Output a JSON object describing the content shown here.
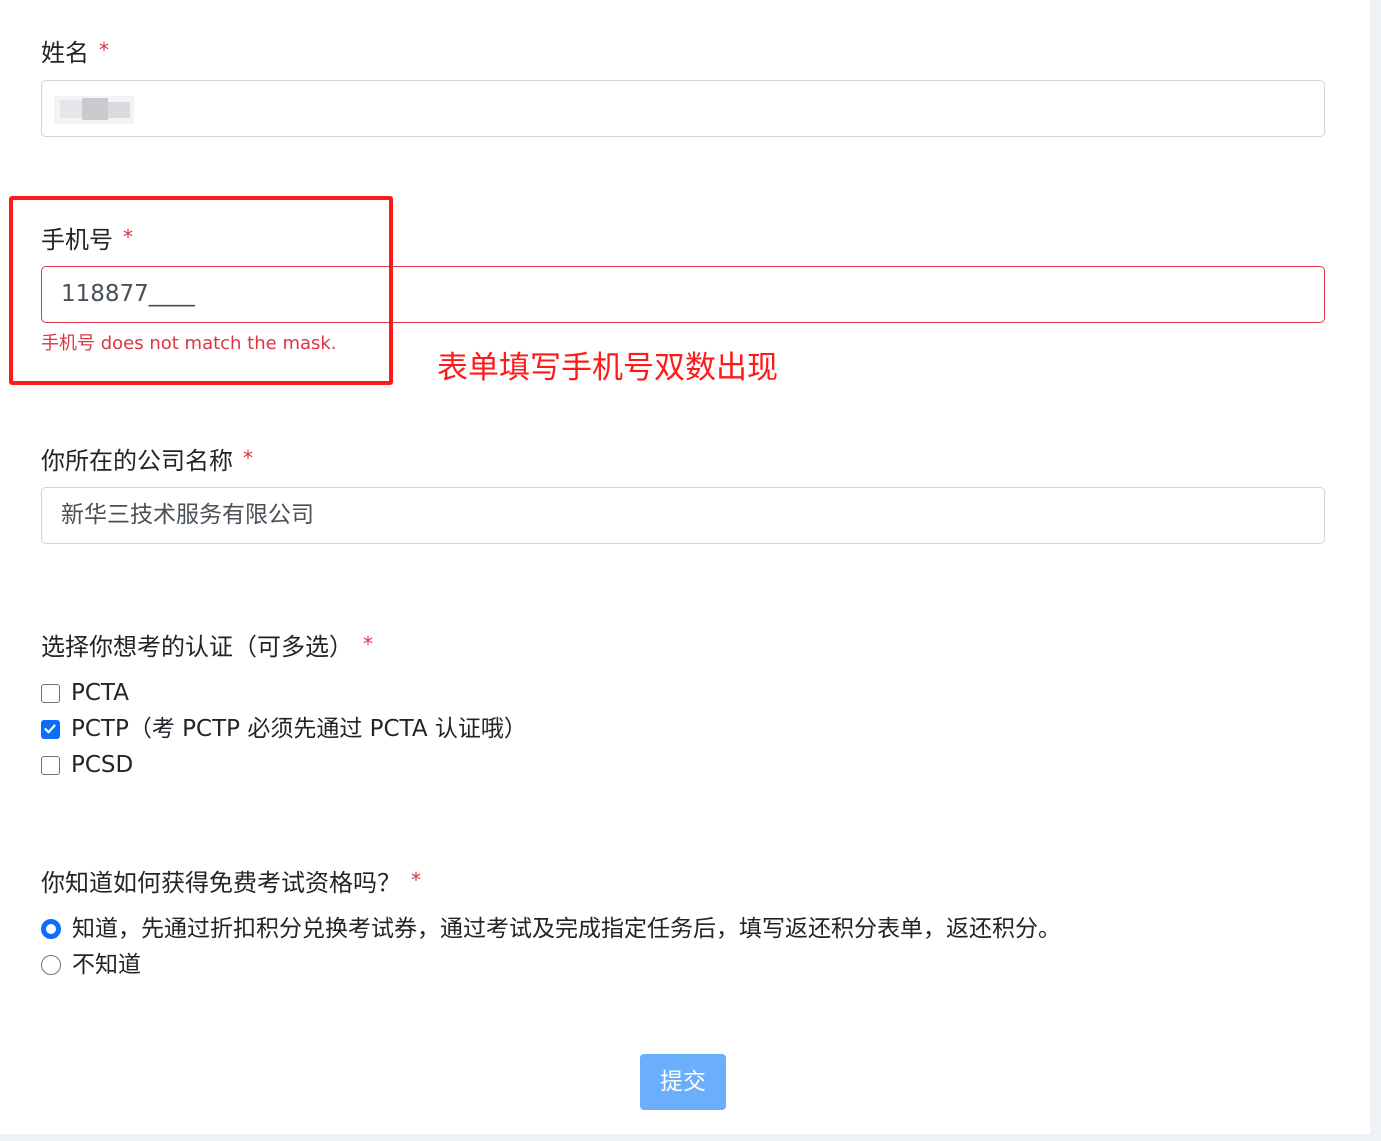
{
  "colors": {
    "required_star": "#dc3545",
    "invalid": "#dc3545",
    "annotation": "#ff1a1a",
    "accent": "#0d6efd",
    "submit_button": "#6aaefc"
  },
  "form": {
    "required_mark": "*",
    "name": {
      "label": "姓名",
      "value": ""
    },
    "phone": {
      "label": "手机号",
      "value": "118877____",
      "error": "手机号 does not match the mask."
    },
    "company": {
      "label": "你所在的公司名称",
      "value": "新华三技术服务有限公司"
    },
    "certs": {
      "label": "选择你想考的认证（可多选）",
      "options": [
        {
          "label": "PCTA",
          "checked": false
        },
        {
          "label": "PCTP（考 PCTP 必须先通过 PCTA 认证哦）",
          "checked": true
        },
        {
          "label": "PCSD",
          "checked": false
        }
      ]
    },
    "free_exam": {
      "label": "你知道如何获得免费考试资格吗？",
      "options": [
        {
          "label": "知道，先通过折扣积分兑换考试券，通过考试及完成指定任务后，填写返还积分表单，返还积分。",
          "selected": true
        },
        {
          "label": "不知道",
          "selected": false
        }
      ]
    },
    "submit_label": "提交"
  },
  "annotation": {
    "text": "表单填写手机号双数出现"
  }
}
